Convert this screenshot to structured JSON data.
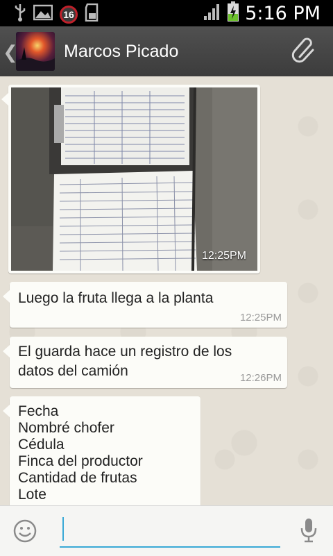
{
  "status_bar": {
    "icons": [
      "usb-icon",
      "image-icon",
      "notification-count-icon",
      "sd-card-icon",
      "signal-icon",
      "battery-charging-icon"
    ],
    "notification_count": "16",
    "time": "5:16 PM"
  },
  "header": {
    "contact_name": "Marcos Picado",
    "back_icon": "chevron-left-icon",
    "attach_icon": "paperclip-icon"
  },
  "messages": [
    {
      "type": "image",
      "time": "12:25PM"
    },
    {
      "type": "text",
      "lines": [
        "Luego la fruta llega a la planta"
      ],
      "time": "12:25PM"
    },
    {
      "type": "text",
      "lines": [
        "El guarda hace un registro de los",
        "datos del camión"
      ],
      "time": "12:26PM"
    },
    {
      "type": "text",
      "lines": [
        "Fecha",
        "Nombré chofer",
        "Cédula",
        "Finca del productor",
        "Cantidad de frutas",
        "Lote"
      ]
    }
  ],
  "input_bar": {
    "emoji_icon": "smiley-icon",
    "placeholder": "",
    "mic_icon": "microphone-icon"
  },
  "colors": {
    "accent": "#39a9d6",
    "action_bar": "#444444",
    "bubble": "#fcfcf8",
    "chat_background": "#e5e0d6"
  }
}
